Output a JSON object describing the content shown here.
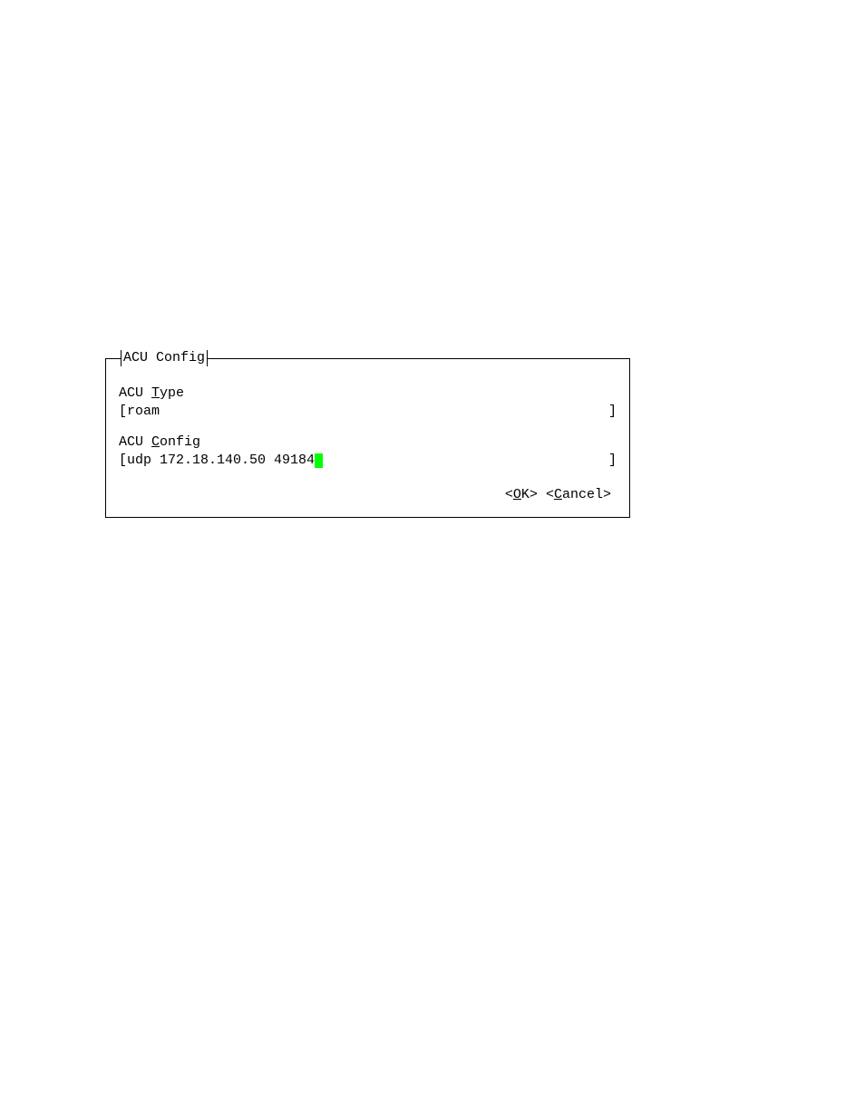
{
  "dialog": {
    "title": "ACU Config",
    "field1": {
      "label_prefix": "ACU ",
      "label_hotkey": "T",
      "label_suffix": "ype",
      "value": "roam"
    },
    "field2": {
      "label_prefix": "ACU ",
      "label_hotkey": "C",
      "label_suffix": "onfig",
      "value": "udp 172.18.140.50 49184"
    },
    "buttons": {
      "ok": {
        "open": "<",
        "hotkey": "O",
        "rest": "K",
        "close": ">"
      },
      "cancel": {
        "open": "<",
        "hotkey": "C",
        "rest": "ancel",
        "close": ">"
      }
    },
    "bracket_open": "[",
    "bracket_close": "]"
  }
}
